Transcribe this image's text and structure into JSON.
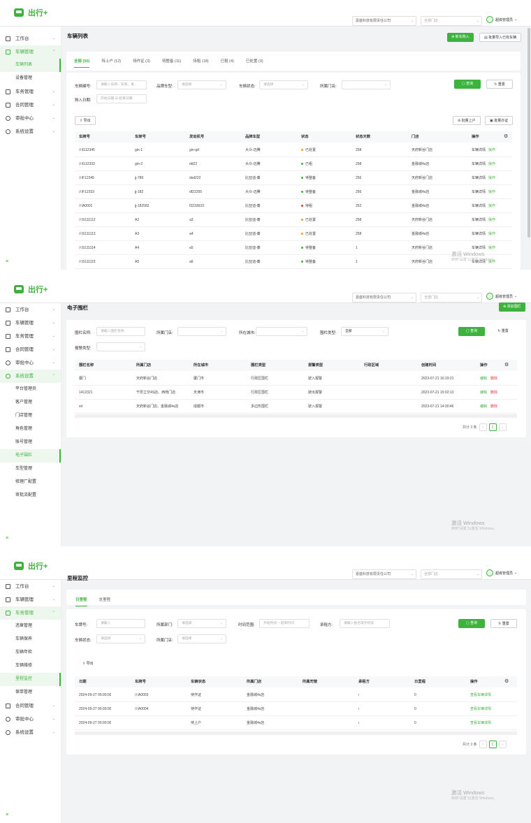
{
  "brand": {
    "name": "出行+",
    "color": "#3db33d"
  },
  "topbar": {
    "company": "嘉盛科技有限责任公司",
    "store": "全部门店",
    "user": "超级管理员"
  },
  "windows_watermark": {
    "title": "激活 Windows",
    "sub": "转到\"设置\"以激活 Windows。"
  },
  "p1": {
    "menu": {
      "workbench": "工作台",
      "vehicle_mgmt": "车辆管理",
      "vehicle_list": "车辆列表",
      "device_mgmt": "设备管理",
      "service_mgmt": "车务管理",
      "contract_mgmt": "合同管理",
      "audit_center": "审批中心",
      "system_settings": "系统设置"
    },
    "title": "车辆列表",
    "btn_new": "新车购入",
    "btn_import": "批量导入已有车辆",
    "tabs": [
      "全部 (50)",
      "待上户 (12)",
      "待作证 (3)",
      "待整备 (11)",
      "待租 (18)",
      "已租 (4)",
      "已处置 (3)"
    ],
    "filters": {
      "plate_label": "车辆编号:",
      "plate_ph": "请输入车牌、车架、发...",
      "brand_label": "品牌车型:",
      "brand_ph": "请选择",
      "status_label": "车辆状态:",
      "status_ph": "请选择",
      "store_label": "所属门店:",
      "date_label": "购入日期:",
      "date_start": "开始日期",
      "date_end": "结束日期",
      "query": "查询",
      "reset": "重置"
    },
    "export": "导出",
    "batch_onboard": "批量上户",
    "batch_cert": "批量办证",
    "columns": [
      "车牌号",
      "车架号",
      "发动机号",
      "品牌车型",
      "状态",
      "状态天数",
      "门店",
      "操作"
    ],
    "rows": [
      {
        "plate": "川G12345",
        "vin": "gin-1",
        "engine": "gin-gd",
        "model": "大众-迈腾",
        "status": "已处置",
        "days": "258",
        "store": "天府新谷门店",
        "op1": "车辆详情",
        "op2": "操作"
      },
      {
        "plate": "川G12333",
        "vin": "gin-2",
        "engine": "dd22",
        "model": "大众-迈腾",
        "status": "已租",
        "days": "258",
        "store": "金融城4s店",
        "op1": "车辆详情",
        "op2": "操作"
      },
      {
        "plate": "川F12345",
        "vin": "jj-786",
        "engine": "dsd222",
        "model": "比亚迪-秦",
        "status": "待整备",
        "days": "256",
        "store": "天府新谷门店",
        "op1": "车辆详情",
        "op2": "操作"
      },
      {
        "plate": "川F12333",
        "vin": "jj-182",
        "engine": "df22255",
        "model": "大众-迈腾",
        "status": "待整备",
        "days": "256",
        "store": "金融城4s店",
        "op1": "车辆详情",
        "op2": "操作"
      },
      {
        "plate": "川A0001",
        "vin": "jj-182582",
        "engine": "f3233633",
        "model": "比亚迪-秦",
        "status": "待租",
        "days": "252",
        "store": "金融城4s店",
        "op1": "车辆详情",
        "op2": "操作"
      },
      {
        "plate": "川S111112",
        "vin": "A2",
        "engine": "a3",
        "model": "比亚迪-秦",
        "status": "已处置",
        "days": "258",
        "store": "天府新谷门店",
        "op1": "车辆详情",
        "op2": "操作"
      },
      {
        "plate": "川S111113",
        "vin": "A3",
        "engine": "a4",
        "model": "比亚迪-秦",
        "status": "已处置",
        "days": "258",
        "store": "金融城4s店",
        "op1": "车辆详情",
        "op2": "操作"
      },
      {
        "plate": "川S111114",
        "vin": "A4",
        "engine": "a5",
        "model": "比亚迪-秦",
        "status": "待整备",
        "days": "1",
        "store": "天府新谷门店",
        "op1": "车辆详情",
        "op2": "操作"
      },
      {
        "plate": "川S111115",
        "vin": "A5",
        "engine": "a6",
        "model": "比亚迪-秦",
        "status": "待整备",
        "days": "1",
        "store": "天府新谷门店",
        "op1": "车辆详情",
        "op2": "操作"
      }
    ]
  },
  "p2": {
    "menu": {
      "workbench": "工作台",
      "vehicle_mgmt": "车辆管理",
      "service_mgmt": "车务管理",
      "contract_mgmt": "合同管理",
      "audit_center": "审批中心",
      "system_settings": "系统设置",
      "platform_mgmt": "平台管理员",
      "customer_mgmt": "客户管理",
      "store_mgmt": "门店管理",
      "role_mgmt": "角色管理",
      "account_mgmt": "账号管理",
      "geofence": "电子围栏",
      "model_mgmt": "车型管理",
      "repair_config": "修理厂配置",
      "approval_config": "审批流配置"
    },
    "title": "电子围栏",
    "btn_add": "添加围栏",
    "filters": {
      "name_label": "围栏名称:",
      "name_ph": "请输入围栏名称",
      "store_label": "所属门店:",
      "city_label": "所在城市:",
      "type_label": "围栏类型:",
      "type_val": "全部",
      "alarm_label": "报警类型:",
      "query": "查询",
      "reset": "重置"
    },
    "columns": [
      "围栏名称",
      "所属门店",
      "所在城市",
      "围栏类型",
      "报警类型",
      "行政区域",
      "创建时间",
      "操作"
    ],
    "rows": [
      {
        "name": "厦门",
        "store": "天府新谷门店",
        "city": "厦门市",
        "type": "行政区围栏",
        "alarm": "驶入报警",
        "region": "",
        "created": "2023-07-21 16:19:21",
        "edit": "编辑",
        "del": "删除"
      },
      {
        "name": "1412321",
        "store": "千厚立交4S店、西苑门店",
        "city": "天津市",
        "type": "行政区围栏",
        "alarm": "驶出报警",
        "region": "",
        "created": "2023-07-21 15:02:13",
        "edit": "编辑",
        "del": "删除"
      },
      {
        "name": "vit",
        "store": "天府新谷门店、金融城4s店",
        "city": "成都市",
        "type": "多边形围栏",
        "alarm": "驶入报警",
        "region": "",
        "created": "2023-07-21 14:30:46",
        "edit": "编辑",
        "del": "删除"
      }
    ],
    "pager": {
      "total": "共计 3 条",
      "page": "1"
    }
  },
  "p3": {
    "menu": {
      "workbench": "工作台",
      "vehicle_mgmt": "车辆管理",
      "service_mgmt": "车务管理",
      "violation_mgmt": "违章管理",
      "insurance": "车辆保养",
      "inspection": "车辆年检",
      "repair": "车辆维修",
      "mileage": "里程监控",
      "policy_mgmt": "保单管理",
      "contract_mgmt": "合同管理",
      "audit_center": "审批中心",
      "system_settings": "系统设置"
    },
    "title": "里程监控",
    "tabs": [
      "日里程",
      "总里程"
    ],
    "filters": {
      "plate_label": "车牌号:",
      "plate_ph": "请输入",
      "store_label": "所属部门:",
      "store_ph": "请选择",
      "time_label": "时间范围:",
      "time_start": "开始时间",
      "time_end": "结束时间",
      "lessee_label": "承租方:",
      "lessee_ph": "请输入姓名或手机号",
      "vstatus_label": "车辆状态:",
      "vstatus_ph": "请选择",
      "store2_label": "所属门店:",
      "store2_ph": "请选择",
      "query": "查询",
      "reset": "重置"
    },
    "export": "导出",
    "columns": [
      "日期",
      "车牌号",
      "车辆状态",
      "所属门店",
      "所属司管",
      "承租方",
      "日里程",
      "操作"
    ],
    "rows": [
      {
        "date": "2024-09-27 00:00:00",
        "plate": "川A0003",
        "status": "待作证",
        "store": "金融城4s店",
        "mgr": "",
        "lessee": "/",
        "mileage": "0",
        "op": "查看车辆详情"
      },
      {
        "date": "2024-09-27 00:00:00",
        "plate": "川A0004",
        "status": "待作证",
        "store": "金融城4s店",
        "mgr": "",
        "lessee": "/",
        "mileage": "0",
        "op": "查看车辆详情"
      },
      {
        "date": "2024-09-27 00:00:00",
        "plate": "",
        "status": "待上户",
        "store": "金融城4s店",
        "mgr": "",
        "lessee": "/",
        "mileage": "0",
        "op": "查看车辆详情"
      }
    ],
    "pager": {
      "total": "共计 3 条",
      "page": "1"
    }
  }
}
